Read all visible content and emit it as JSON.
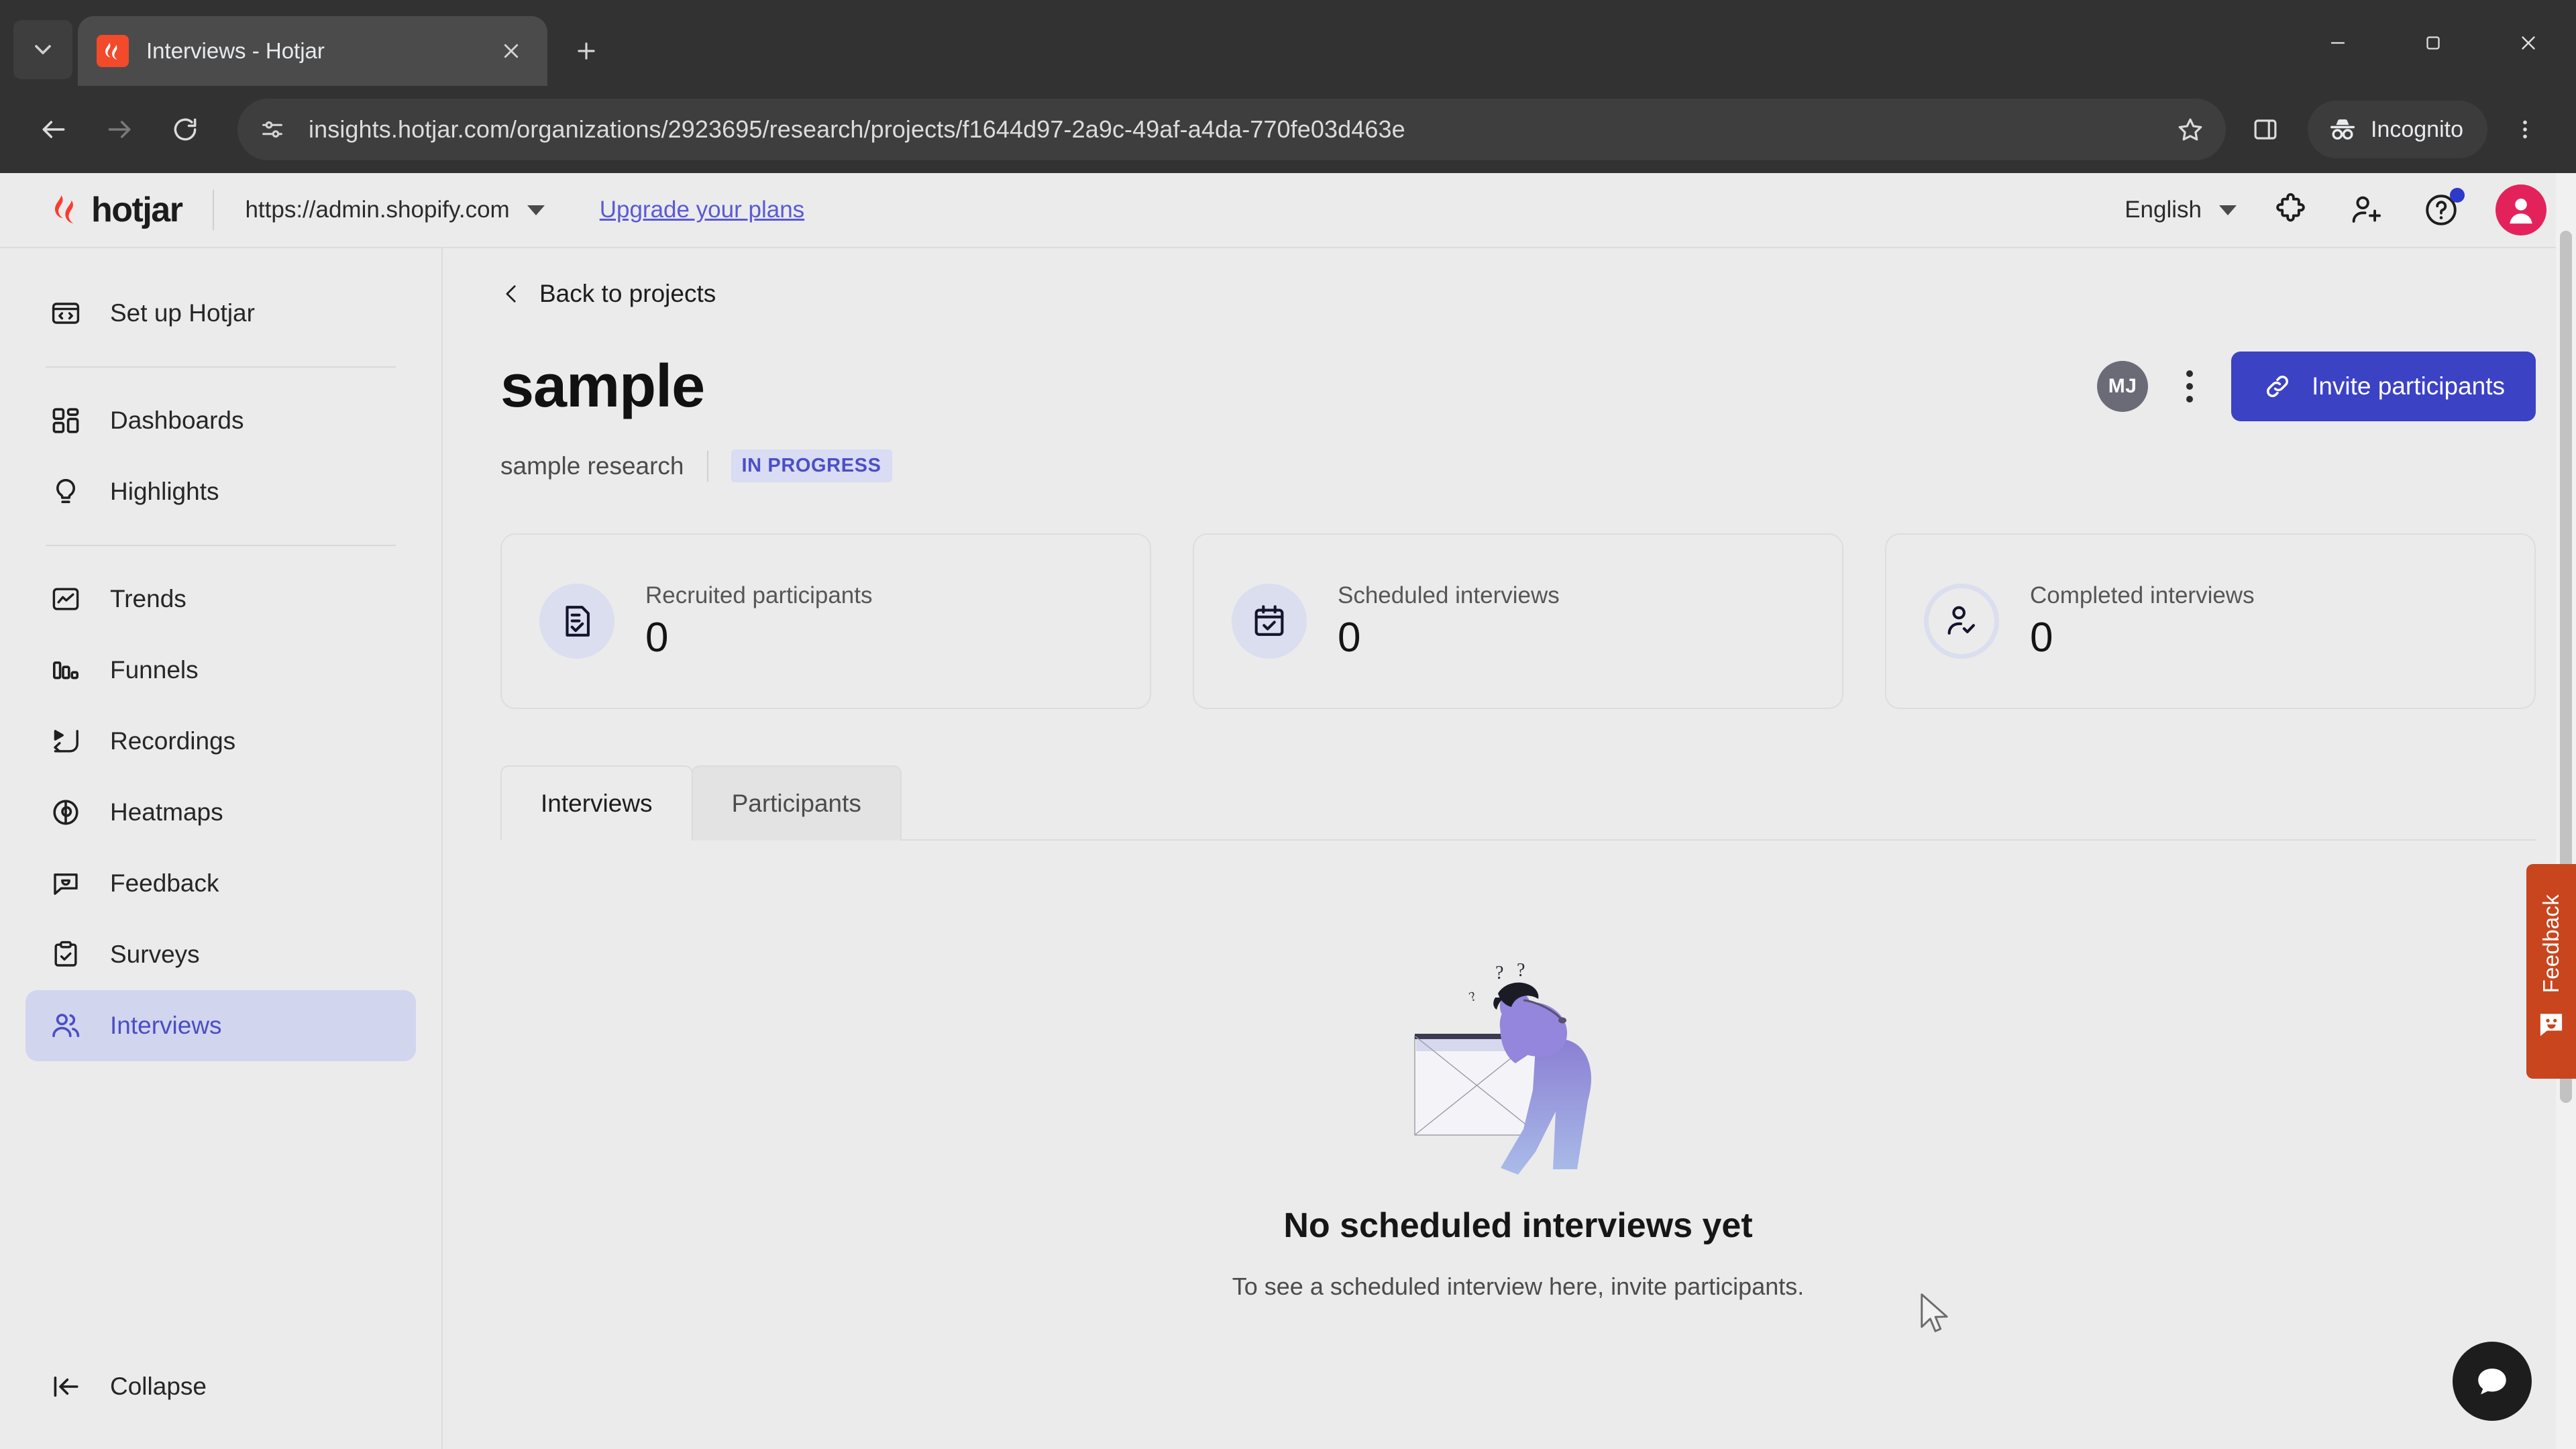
{
  "browser": {
    "tab": {
      "title": "Interviews - Hotjar",
      "favicon": "hotjar-favicon"
    },
    "new_tab_label": "New tab",
    "url": "insights.hotjar.com/organizations/2923695/research/projects/f1644d97-2a9c-49af-a4da-770fe03d463e",
    "incognito_label": "Incognito",
    "controls": {
      "back": "back-icon",
      "forward": "forward-icon",
      "reload": "reload-icon",
      "bookmark": "star-icon",
      "sidepanel": "side-panel-icon",
      "menu": "kebab-menu-icon"
    },
    "window": {
      "minimize": "minimize-icon",
      "maximize": "maximize-icon",
      "close": "close-icon"
    }
  },
  "app_header": {
    "brand": "hotjar",
    "site": "https://admin.shopify.com",
    "upgrade_link": "Upgrade your plans",
    "language": "English",
    "icons": {
      "extensions": "puzzle-icon",
      "invite_user": "add-user-icon",
      "help": "help-icon",
      "avatar": "user-avatar"
    }
  },
  "sidebar": {
    "items": [
      {
        "label": "Set up Hotjar",
        "icon": "code-window-icon",
        "active": false
      },
      {
        "label": "Dashboards",
        "icon": "grid-icon",
        "active": false
      },
      {
        "label": "Highlights",
        "icon": "bulb-icon",
        "active": false
      },
      {
        "label": "Trends",
        "icon": "trend-chart-icon",
        "active": false
      },
      {
        "label": "Funnels",
        "icon": "bars-icon",
        "active": false
      },
      {
        "label": "Recordings",
        "icon": "cursor-play-icon",
        "active": false
      },
      {
        "label": "Heatmaps",
        "icon": "heatmap-pin-icon",
        "active": false
      },
      {
        "label": "Feedback",
        "icon": "chat-smile-icon",
        "active": false
      },
      {
        "label": "Surveys",
        "icon": "clipboard-check-icon",
        "active": false
      },
      {
        "label": "Interviews",
        "icon": "people-icon",
        "active": true
      }
    ],
    "collapse": {
      "label": "Collapse",
      "icon": "collapse-left-icon"
    }
  },
  "main": {
    "back_link": "Back to projects",
    "project_title": "sample",
    "project_subtitle": "sample research",
    "status_badge": "IN PROGRESS",
    "owner_initials": "MJ",
    "more_menu": "more-options-icon",
    "invite_button": "Invite participants",
    "invite_icon": "link-icon",
    "stats": [
      {
        "label": "Recruited participants",
        "value": "0",
        "icon": "document-check-icon",
        "style": "filled"
      },
      {
        "label": "Scheduled interviews",
        "value": "0",
        "icon": "calendar-check-icon",
        "style": "filled"
      },
      {
        "label": "Completed interviews",
        "value": "0",
        "icon": "person-check-icon",
        "style": "ring"
      }
    ],
    "tabs": [
      {
        "label": "Interviews",
        "active": true
      },
      {
        "label": "Participants",
        "active": false
      }
    ],
    "empty_state": {
      "illustration": "confused-person-broken-image",
      "title": "No scheduled interviews yet",
      "subtitle": "To see a scheduled interview here, invite participants."
    }
  },
  "widgets": {
    "feedback_tab": {
      "label": "Feedback",
      "icon": "smiley-chat-icon",
      "color": "#c8451e"
    },
    "chat_button": {
      "icon": "chat-bubble-icon",
      "color": "#1d1d1d"
    }
  },
  "colors": {
    "accent": "#3c42c4",
    "sidebar_active_bg": "#d2d5ee",
    "sidebar_active_fg": "#4a4ec4",
    "badge_bg": "#d9dcf2",
    "badge_fg": "#4b4fc6",
    "brand_red": "#f24a2a",
    "page_bg": "#ebebeb"
  }
}
